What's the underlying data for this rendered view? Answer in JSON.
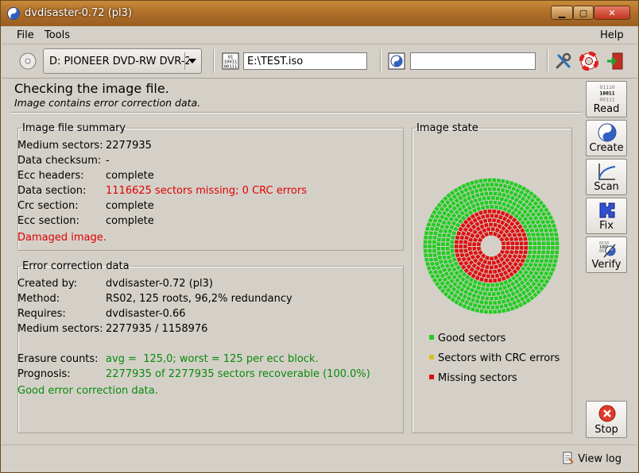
{
  "window": {
    "title": "dvdisaster-0.72 (pl3)"
  },
  "menu": {
    "file": "File",
    "tools": "Tools",
    "help": "Help"
  },
  "toolbar": {
    "drive": "D: PIONEER DVD-RW DVR-2",
    "image_file": "E:\\TEST.iso",
    "ecc_file": ""
  },
  "status": {
    "title": "Checking the image file.",
    "subtitle": "Image contains error correction data."
  },
  "summary": {
    "legend": "Image file summary",
    "rows": [
      {
        "key": "Medium sectors:",
        "value": "2277935"
      },
      {
        "key": "Data checksum:",
        "value": "-"
      },
      {
        "key": "Ecc headers:",
        "value": "complete"
      },
      {
        "key": "Data section:",
        "value": "1116625 sectors missing; 0 CRC errors"
      },
      {
        "key": "Crc section:",
        "value": "complete"
      },
      {
        "key": "Ecc section:",
        "value": "complete"
      }
    ],
    "verdict": "Damaged image."
  },
  "ecc": {
    "legend": "Error correction data",
    "rows": [
      {
        "key": "Created by:",
        "value": "dvdisaster-0.72 (pl3)"
      },
      {
        "key": "Method:",
        "value": "RS02, 125 roots, 96,2% redundancy"
      },
      {
        "key": "Requires:",
        "value": "dvdisaster-0.66"
      },
      {
        "key": "Medium sectors:",
        "value": "2277935 / 1158976"
      },
      {
        "key": "Erasure counts:",
        "value": "avg =  125,0; worst = 125 per ecc block."
      },
      {
        "key": "Prognosis:",
        "value": "2277935 of 2277935 sectors recoverable (100.0%)"
      }
    ],
    "verdict": "Good error correction data."
  },
  "image_state": {
    "legend": "Image state",
    "missing_fraction": 0.49,
    "legend_items": [
      {
        "label": "Good sectors",
        "color": "#22cc22"
      },
      {
        "label": "Sectors with CRC errors",
        "color": "#d8c020"
      },
      {
        "label": "Missing sectors",
        "color": "#dd1010"
      }
    ]
  },
  "side": {
    "read": "Read",
    "create": "Create",
    "scan": "Scan",
    "fix": "Fix",
    "verify": "Verify",
    "stop": "Stop"
  },
  "footer": {
    "view_log": "View log"
  },
  "colors": {
    "good": "#22cc22",
    "missing": "#dd1010",
    "crc": "#d8c020"
  }
}
